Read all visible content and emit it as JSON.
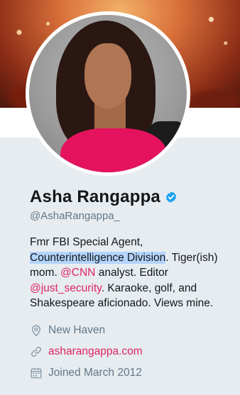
{
  "profile": {
    "name": "Asha Rangappa",
    "handle": "@AshaRangappa_",
    "verified": true,
    "bio": {
      "part1": "Fmr FBI Special Agent,",
      "highlighted": "Counterintelligence Division",
      "part2": ". Tiger(ish) mom. ",
      "mention1": "@CNN",
      "part3": " analyst. Editor ",
      "mention2": "@just_security",
      "part4": ". Karaoke, golf, and Shakespeare aficionado. Views mine."
    },
    "location": "New Haven",
    "website": "asharangappa.com",
    "joined": "Joined March 2012"
  },
  "icons": {
    "verified": "verified-badge-icon",
    "location": "location-pin-icon",
    "website": "link-icon",
    "joined": "calendar-icon"
  },
  "colors": {
    "accent": "#e0245e",
    "verified": "#1da1f2",
    "secondary_text": "#657786",
    "highlight": "#b3d4fc"
  }
}
